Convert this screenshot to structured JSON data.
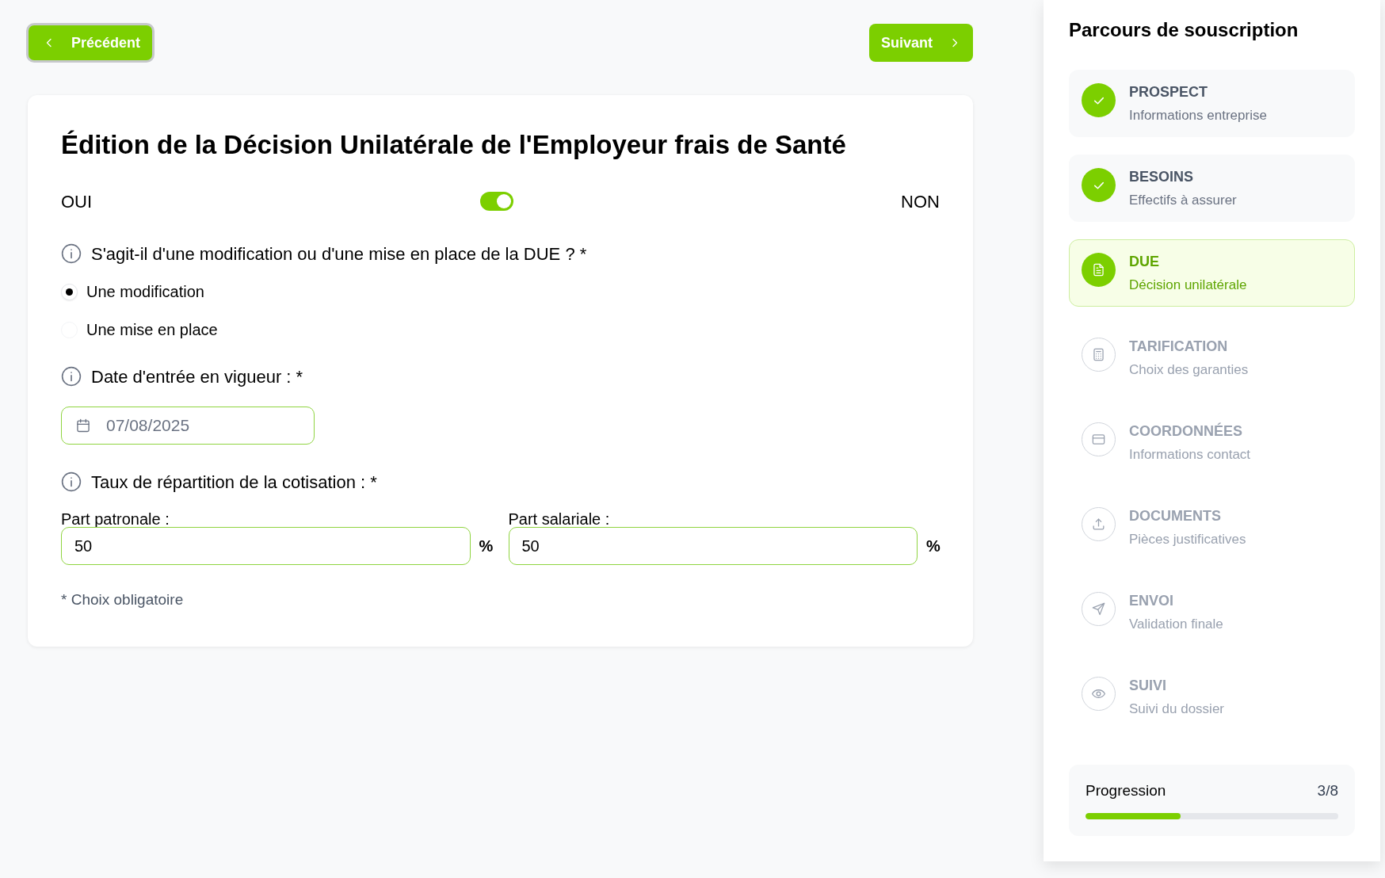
{
  "nav": {
    "previous": {
      "label": "Précédent"
    },
    "next": {
      "label": "Suivant"
    }
  },
  "form": {
    "title": "Édition de la Décision Unilatérale de l'Employeur frais de Santé",
    "switch_row": {
      "left_label": "OUI",
      "on": true,
      "right_label": "NON"
    },
    "sections": [
      {
        "kind": "radio",
        "question": "S'agit-il d'une modification ou d'une mise en place de la DUE ? *",
        "options": [
          {
            "label": "Une modification",
            "selected": true
          },
          {
            "label": "Une mise en place",
            "selected": false
          }
        ]
      },
      {
        "kind": "date",
        "question": "Date d'entrée en vigueur : *",
        "value": "07/08/2025"
      },
      {
        "kind": "split",
        "question": "Taux de répartition de la cotisation : *",
        "fields": [
          {
            "label": "Part patronale :",
            "value": "50",
            "unit": "%"
          },
          {
            "label": "Part salariale :",
            "value": "50",
            "unit": "%"
          }
        ]
      }
    ],
    "footnote": "* Choix obligatoire"
  },
  "sidebar": {
    "title": "Parcours de souscription",
    "steps": [
      {
        "title": "PROSPECT",
        "subtitle": "Informations entreprise",
        "completed": true,
        "selected": false
      },
      {
        "title": "BESOINS",
        "subtitle": "Effectifs à assurer",
        "completed": true,
        "selected": false
      },
      {
        "title": "DUE",
        "subtitle": "Décision unilatérale",
        "completed": false,
        "selected": true
      },
      {
        "title": "TARIFICATION",
        "subtitle": "Choix des garanties",
        "completed": false,
        "selected": false
      },
      {
        "title": "COORDONNÉES",
        "subtitle": "Informations contact",
        "completed": false,
        "selected": false
      },
      {
        "title": "DOCUMENTS",
        "subtitle": "Pièces justificatives",
        "completed": false,
        "selected": false
      },
      {
        "title": "ENVOI",
        "subtitle": "Validation finale",
        "completed": false,
        "selected": false
      },
      {
        "title": "SUIVI",
        "subtitle": "Suivi du dossier",
        "completed": false,
        "selected": false
      }
    ],
    "progress": {
      "label": "Progression",
      "count": "3/8",
      "level": 0.375
    }
  }
}
